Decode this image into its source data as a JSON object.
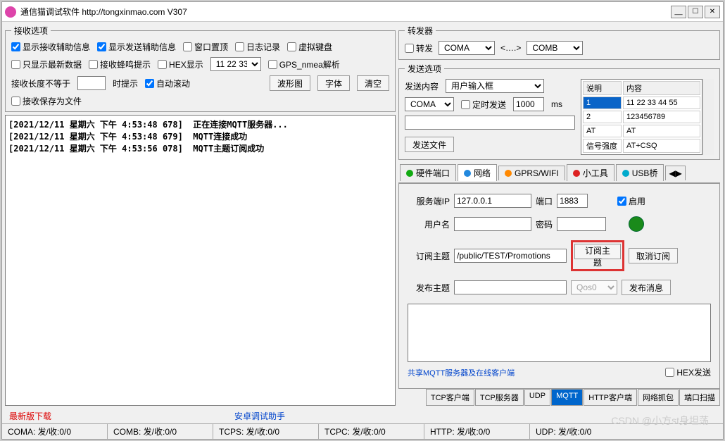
{
  "window": {
    "title": "通信猫调试软件   http://tongxinmao.com   V307"
  },
  "recv_options": {
    "legend": "接收选项",
    "show_recv_aux": "显示接收辅助信息",
    "show_send_aux": "显示发送辅助信息",
    "topmost": "窗口置顶",
    "logging": "日志记录",
    "virtual_kbd": "虚拟键盘",
    "only_newest": "只显示最新数据",
    "beep": "接收蜂鸣提示",
    "hex_display": "HEX显示",
    "hex_val": "11 22 33",
    "gps": "GPS_nmea解析",
    "recv_len_neq": "接收长度不等于",
    "when_show": "时提示",
    "auto_scroll": "自动滚动",
    "waveform": "波形图",
    "font": "字体",
    "clear": "清空",
    "save_file": "接收保存为文件"
  },
  "log": [
    "[2021/12/11 星期六 下午 4:53:48 678]  正在连接MQTT服务器...",
    "[2021/12/11 星期六 下午 4:53:48 679]  MQTT连接成功",
    "[2021/12/11 星期六 下午 4:53:56 078]  MQTT主题订阅成功"
  ],
  "links": {
    "latest": "最新版下载",
    "android": "安卓调试助手"
  },
  "forwarder": {
    "legend": "转发器",
    "forward": "转发",
    "from": "COMA",
    "arrow": "<….>",
    "to": "COMB"
  },
  "send_options": {
    "legend": "发送选项",
    "content_lbl": "发送内容",
    "content_sel": "用户输入框",
    "port": "COMA",
    "timed": "定时发送",
    "interval": "1000",
    "ms": "ms",
    "send_file": "发送文件",
    "th1": "说明",
    "th2": "内容",
    "rows": [
      {
        "c1": "1",
        "c2": "11 22 33 44 55"
      },
      {
        "c1": "2",
        "c2": "123456789"
      },
      {
        "c1": "AT",
        "c2": "AT"
      },
      {
        "c1": "信号强度",
        "c2": "AT+CSQ"
      }
    ]
  },
  "tabs": {
    "hw": "硬件端口",
    "net": "网络",
    "gprs": "GPRS/WIFI",
    "tools": "小工具",
    "usb": "USB桥"
  },
  "net": {
    "server_ip_lbl": "服务端IP",
    "server_ip": "127.0.0.1",
    "port_lbl": "端口",
    "port": "1883",
    "enable": "启用",
    "user_lbl": "用户名",
    "pass_lbl": "密码",
    "sub_topic_lbl": "订阅主题",
    "sub_topic": "/public/TEST/Promotions",
    "subscribe": "订阅主题",
    "unsubscribe": "取消订阅",
    "pub_topic_lbl": "发布主题",
    "qos": "Qos0",
    "publish": "发布消息",
    "hex_send": "HEX发送",
    "share": "共享MQTT服务器及在线客户端"
  },
  "subtabs": {
    "tcp_client": "TCP客户端",
    "tcp_server": "TCP服务器",
    "udp": "UDP",
    "mqtt": "MQTT",
    "http_client": "HTTP客户端",
    "net_sniff": "网络抓包",
    "port_scan": "端口扫描"
  },
  "status": {
    "coma": "COMA: 发/收:0/0",
    "comb": "COMB: 发/收:0/0",
    "tcps": "TCPS: 发/收:0/0",
    "tcpc": "TCPC: 发/收:0/0",
    "http": "HTTP: 发/收:0/0",
    "udp": "UDP: 发/收:0/0"
  },
  "watermark": "CSDN @小方st身坦荡"
}
